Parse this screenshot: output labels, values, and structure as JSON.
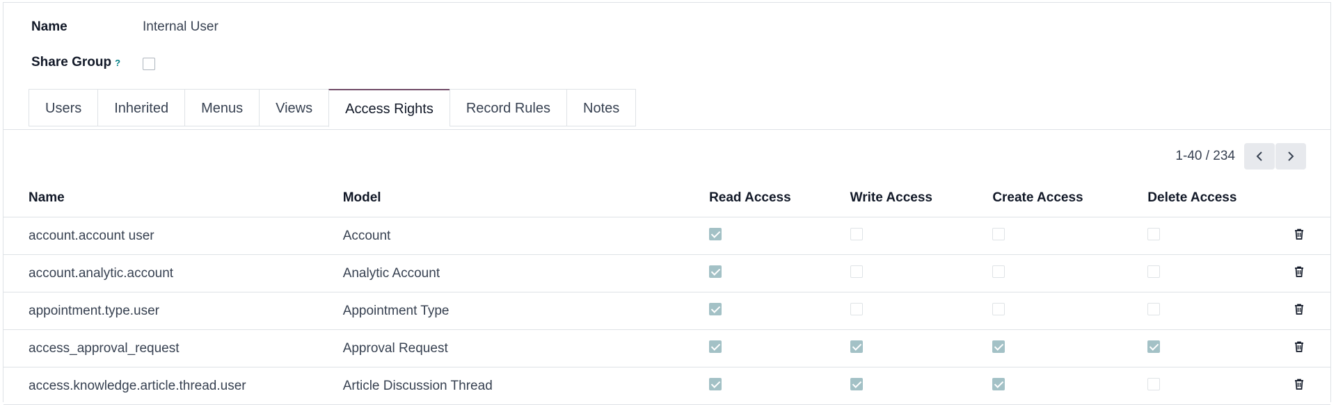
{
  "form": {
    "name_label": "Name",
    "name_value": "Internal User",
    "share_group_label": "Share Group",
    "share_group_help": "?"
  },
  "tabs": [
    {
      "label": "Users",
      "active": false
    },
    {
      "label": "Inherited",
      "active": false
    },
    {
      "label": "Menus",
      "active": false
    },
    {
      "label": "Views",
      "active": false
    },
    {
      "label": "Access Rights",
      "active": true
    },
    {
      "label": "Record Rules",
      "active": false
    },
    {
      "label": "Notes",
      "active": false
    }
  ],
  "pager": {
    "value": "1-40 / 234"
  },
  "table": {
    "headers": {
      "name": "Name",
      "model": "Model",
      "read": "Read Access",
      "write": "Write Access",
      "create": "Create Access",
      "delete": "Delete Access"
    },
    "rows": [
      {
        "name": "account.account user",
        "model": "Account",
        "read": true,
        "write": false,
        "create": false,
        "delete": false
      },
      {
        "name": "account.analytic.account",
        "model": "Analytic Account",
        "read": true,
        "write": false,
        "create": false,
        "delete": false
      },
      {
        "name": "appointment.type.user",
        "model": "Appointment Type",
        "read": true,
        "write": false,
        "create": false,
        "delete": false
      },
      {
        "name": "access_approval_request",
        "model": "Approval Request",
        "read": true,
        "write": true,
        "create": true,
        "delete": true
      },
      {
        "name": "access.knowledge.article.thread.user",
        "model": "Article Discussion Thread",
        "read": true,
        "write": true,
        "create": true,
        "delete": false
      }
    ]
  }
}
